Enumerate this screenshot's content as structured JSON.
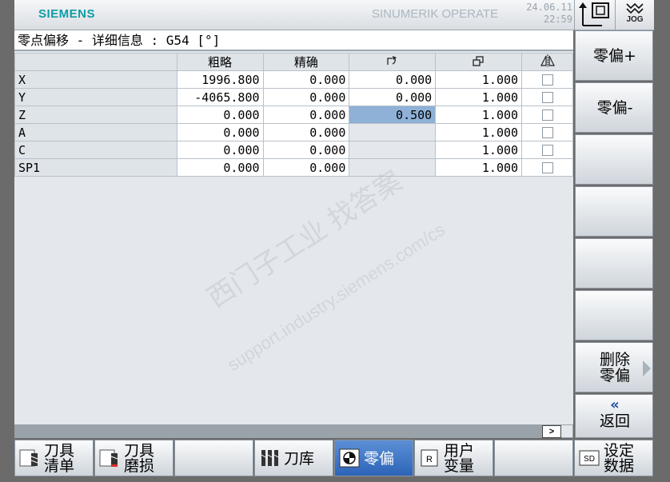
{
  "header": {
    "brand": "SIEMENS",
    "product": "SINUMERIK OPERATE",
    "date": "24.06.11",
    "time": "22:59",
    "mode_label": "JOG"
  },
  "main": {
    "title": "零点偏移 - 详细信息 : G54 [°]",
    "columns": [
      "",
      "粗略",
      "精确",
      "rotation-icon",
      "scale-icon",
      "mirror-icon"
    ],
    "rows": [
      {
        "axis": "X",
        "coarse": "1996.800",
        "fine": "0.000",
        "rotation": "0.000",
        "scale": "1.000",
        "mirror": false
      },
      {
        "axis": "Y",
        "coarse": "-4065.800",
        "fine": "0.000",
        "rotation": "0.000",
        "scale": "1.000",
        "mirror": false
      },
      {
        "axis": "Z",
        "coarse": "0.000",
        "fine": "0.000",
        "rotation": "0.500",
        "scale": "1.000",
        "mirror": false
      },
      {
        "axis": "A",
        "coarse": "0.000",
        "fine": "0.000",
        "rotation": "",
        "scale": "1.000",
        "mirror": false
      },
      {
        "axis": "C",
        "coarse": "0.000",
        "fine": "0.000",
        "rotation": "",
        "scale": "1.000",
        "mirror": false
      },
      {
        "axis": "SP1",
        "coarse": "0.000",
        "fine": "0.000",
        "rotation": "",
        "scale": "1.000",
        "mirror": false
      }
    ],
    "selected_cell": "Z.rotation",
    "scroll_button": ">",
    "watermark_line1": "西门子工业  找答案",
    "watermark_line2": "support.industry.siemens.com/cs"
  },
  "right_softkeys": [
    {
      "label": "零偏+"
    },
    {
      "label": "零偏-"
    },
    {
      "label": ""
    },
    {
      "label": ""
    },
    {
      "label": ""
    },
    {
      "label": ""
    },
    {
      "label": "删除\n零偏"
    },
    {
      "label": "返回",
      "icon": "double-chevron-left-icon"
    }
  ],
  "bottom_softkeys": [
    {
      "label": "刀具\n清单",
      "icon": "tool-list-icon"
    },
    {
      "label": "刀具\n磨损",
      "icon": "tool-wear-icon"
    },
    {
      "label": ""
    },
    {
      "label": "刀库",
      "icon": "magazine-icon"
    },
    {
      "label": "零偏",
      "icon": "work-offset-icon",
      "active": true
    },
    {
      "label": "用户\n变量",
      "icon": "user-variable-icon",
      "icon_text": "R"
    },
    {
      "label": ""
    },
    {
      "label": "设定\n数据",
      "icon": "setting-data-icon",
      "icon_text": "SD"
    }
  ],
  "colors": {
    "brand": "#0f9ca6",
    "selected_cell": "#8fb1d8",
    "active_softkey": "#2d64b8"
  }
}
